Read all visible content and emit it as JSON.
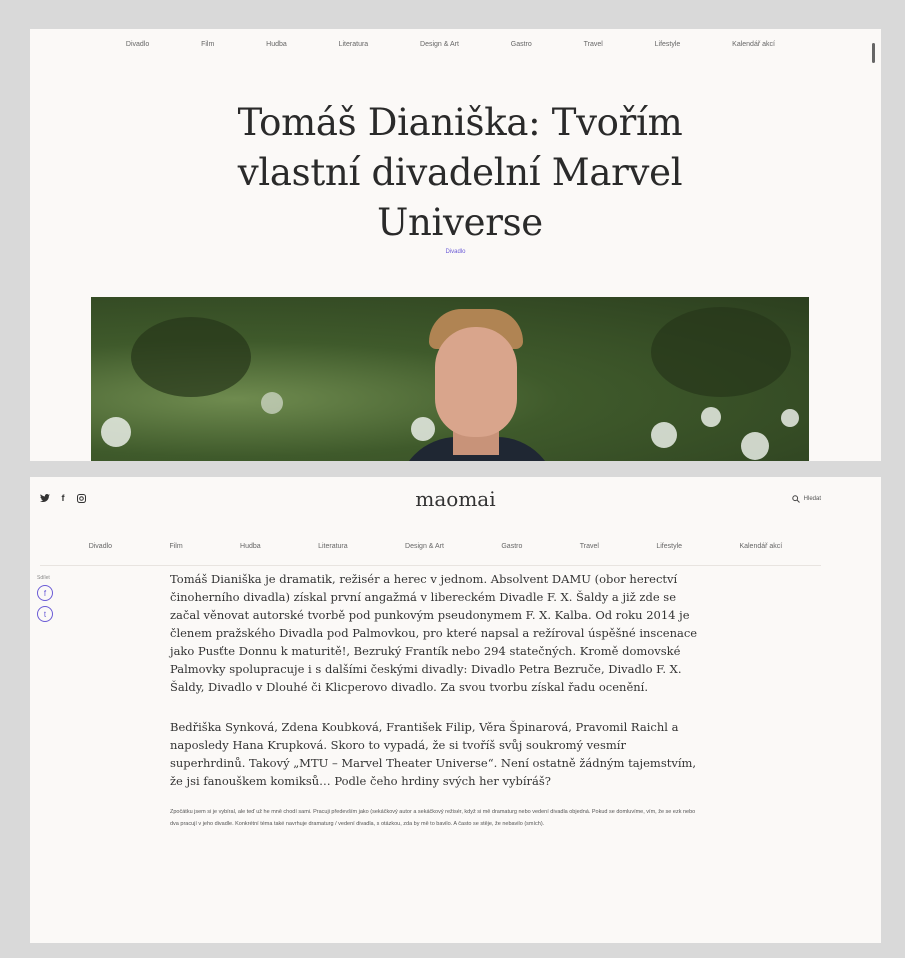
{
  "nav": {
    "items": [
      "Divadlo",
      "Film",
      "Hudba",
      "Literatura",
      "Design & Art",
      "Gastro",
      "Travel",
      "Lifestyle",
      "Kalendář akcí"
    ]
  },
  "article": {
    "title": "Tomáš Dianiška: Tvořím vlastní divadelní Marvel Universe",
    "category": "Divadlo",
    "paragraphs": [
      "Tomáš Dianiška je dramatik, režisér a herec v jednom. Absolvent DAMU (obor herectví činoherního divadla) získal první angažmá v libereckém Divadle F. X. Šaldy a již zde se začal věnovat autorské tvorbě pod punkovým pseudonymem F. X. Kalba. Od roku 2014 je členem pražského Divadla pod Palmovkou, pro které napsal a režíroval úspěšné inscenace jako Pusťte Donnu k maturitě!, Bezruký Frantík nebo 294 statečných. Kromě domovské Palmovky spolupracuje i s dalšími českými divadly: Divadlo Petra Bezruče, Divadlo F. X. Šaldy, Divadlo v Dlouhé či Klicperovo divadlo. Za svou tvorbu získal řadu ocenění.",
      "Bedřiška Synková, Zdena Koubková, František Filip, Věra Špinarová, Pravomil Raichl a naposledy Hana Krupková. Skoro to vypadá, že si tvoříš svůj soukromý vesmír superhrdinů. Takový „MTU – Marvel Theater Universe“. Není ostatně žádným tajemstvím, že jsi fanouškem komiksů… Podle čeho hrdiny svých her vybíráš?",
      "Zpočátku jsem si je vybíral, ale teď už he mně chodí sami. Pracuji především jako (sekáčkový autor a sekáčkový režisér, když si mě dramaturg nebo vedení divadla objedná. Pokud se domluvíme, vím, že se ezk nebo dva pracují v jeho divadle. Konkrétní téma také navrhuje dramaturg / vedení divadla, s otázkou, zda by mě to bavilo. A často se stěje, že nebavilo (smích)."
    ]
  },
  "header": {
    "brand": "maomai",
    "search_label": "Hledat",
    "social_icons": [
      "twitter-icon",
      "facebook-icon",
      "instagram-icon"
    ]
  },
  "share": {
    "label": "Sdílet",
    "facebook_glyph": "f",
    "twitter_glyph": "t"
  },
  "colors": {
    "accent": "#6b5bd6",
    "page_bg": "#fbf9f7"
  }
}
